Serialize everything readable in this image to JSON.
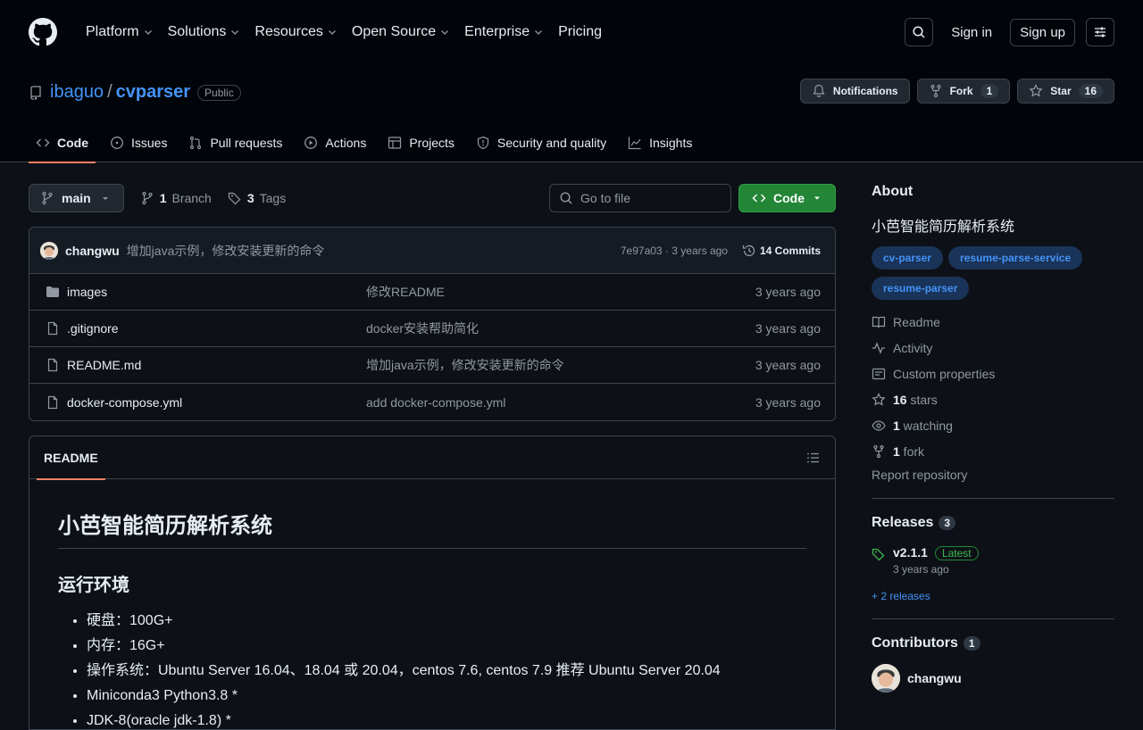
{
  "topnav": {
    "items": [
      {
        "label": "Platform"
      },
      {
        "label": "Solutions"
      },
      {
        "label": "Resources"
      },
      {
        "label": "Open Source"
      },
      {
        "label": "Enterprise"
      },
      {
        "label": "Pricing"
      }
    ],
    "signin": "Sign in",
    "signup": "Sign up"
  },
  "repo": {
    "owner": "ibaguo",
    "separator": "/",
    "name": "cvparser",
    "visibility": "Public",
    "notifications_label": "Notifications",
    "fork_label": "Fork",
    "fork_count": "1",
    "star_label": "Star",
    "star_count": "16"
  },
  "tabs": [
    {
      "label": "Code",
      "icon": "code-icon"
    },
    {
      "label": "Issues",
      "icon": "issue-icon"
    },
    {
      "label": "Pull requests",
      "icon": "pull-request-icon"
    },
    {
      "label": "Actions",
      "icon": "play-icon"
    },
    {
      "label": "Projects",
      "icon": "table-icon"
    },
    {
      "label": "Security and quality",
      "icon": "shield-icon"
    },
    {
      "label": "Insights",
      "icon": "graph-icon"
    }
  ],
  "toolbar": {
    "branch": "main",
    "branch_count": "1",
    "branch_label": "Branch",
    "tag_count": "3",
    "tag_label": "Tags",
    "goto_placeholder": "Go to file",
    "code_label": "Code"
  },
  "commit": {
    "author": "changwu",
    "message": "增加java示例，修改安装更新的命令",
    "meta": "7e97a03 · 3 years ago",
    "commits": "14 Commits"
  },
  "files": [
    {
      "name": "images",
      "type": "folder",
      "message": "修改README",
      "age": "3 years ago"
    },
    {
      "name": ".gitignore",
      "type": "file",
      "message": "docker安装帮助简化",
      "age": "3 years ago"
    },
    {
      "name": "README.md",
      "type": "file",
      "message": "增加java示例，修改安装更新的命令",
      "age": "3 years ago"
    },
    {
      "name": "docker-compose.yml",
      "type": "file",
      "message": "add docker-compose.yml",
      "age": "3 years ago"
    }
  ],
  "readme": {
    "tab": "README",
    "h1": "小芭智能简历解析系统",
    "h2": "运行环境",
    "items": [
      "硬盘：100G+",
      "内存：16G+",
      "操作系统：Ubuntu Server 16.04、18.04 或 20.04，centos 7.6, centos 7.9 推荐 Ubuntu Server 20.04",
      "Miniconda3 Python3.8 *",
      "JDK-8(oracle jdk-1.8) *"
    ]
  },
  "about": {
    "title": "About",
    "description": "小芭智能简历解析系统",
    "topics": [
      "cv-parser",
      "resume-parse-service",
      "resume-parser"
    ],
    "links": [
      {
        "icon": "book-icon",
        "bold": "",
        "text": "Readme"
      },
      {
        "icon": "pulse-icon",
        "bold": "",
        "text": "Activity"
      },
      {
        "icon": "note-icon",
        "bold": "",
        "text": "Custom properties"
      },
      {
        "icon": "star-icon",
        "bold": "16",
        "text": " stars"
      },
      {
        "icon": "eye-icon",
        "bold": "1",
        "text": " watching"
      },
      {
        "icon": "fork-icon",
        "bold": "1",
        "text": " fork"
      }
    ],
    "report": "Report repository"
  },
  "releases": {
    "title": "Releases",
    "count": "3",
    "version": "v2.1.1",
    "latest": "Latest",
    "date": "3 years ago",
    "more": "+ 2 releases"
  },
  "contributors": {
    "title": "Contributors",
    "count": "1",
    "name": "changwu"
  },
  "colors": {
    "accent": "#4493f8",
    "green": "#238636",
    "tab_underline": "#f78166"
  }
}
